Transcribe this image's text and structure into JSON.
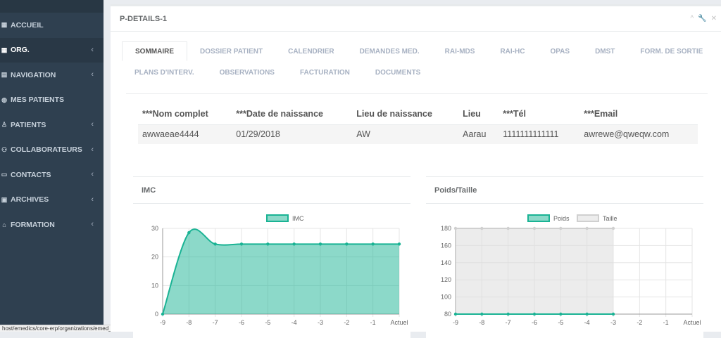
{
  "sidebar": {
    "items": [
      {
        "label": "ACCUEIL",
        "icon": "grid-icon",
        "chevron": false
      },
      {
        "label": "ORG.",
        "icon": "grid-icon",
        "chevron": true,
        "active": true
      },
      {
        "label": "NAVIGATION",
        "icon": "navigation-icon",
        "chevron": true
      },
      {
        "label": "MES PATIENTS",
        "icon": "globe-icon",
        "chevron": false
      },
      {
        "label": "PATIENTS",
        "icon": "user-icon",
        "chevron": true
      },
      {
        "label": "COLLABORATEURS",
        "icon": "users-icon",
        "chevron": true
      },
      {
        "label": "CONTACTS",
        "icon": "contact-card-icon",
        "chevron": true
      },
      {
        "label": "ARCHIVES",
        "icon": "archive-icon",
        "chevron": true
      },
      {
        "label": "FORMATION",
        "icon": "graduation-cap-icon",
        "chevron": true
      }
    ],
    "chevron_glyph": "‹"
  },
  "status_url": "host/emedics/core-erp/organizations/emed_org_update.php",
  "panel": {
    "title": "P-DETAILS-1",
    "tools": [
      "^",
      "🔧",
      "✕"
    ]
  },
  "tabs_row1": [
    "SOMMAIRE",
    "DOSSIER PATIENT",
    "CALENDRIER",
    "DEMANDES MED.",
    "RAI-MDS",
    "RAI-HC",
    "OPAS",
    "DMST",
    "FORM. DE SORTIE"
  ],
  "tabs_row2": [
    "PLANS D'INTERV.",
    "OBSERVATIONS",
    "FACTURATION",
    "DOCUMENTS"
  ],
  "patient_table": {
    "headers": [
      "***Nom complet",
      "***Date de naissance",
      "Lieu de naissance",
      "Lieu",
      "***Tél",
      "***Email"
    ],
    "row": [
      "awwaeae4444",
      "01/29/2018",
      "AW",
      "Aarau",
      "1111111111111",
      "awrewe@qweqw.com"
    ]
  },
  "imc_box": {
    "title": "IMC"
  },
  "poids_box": {
    "title": "Poids/Taille"
  },
  "chart_data": [
    {
      "type": "area",
      "title": "",
      "categories": [
        "-9",
        "-8",
        "-7",
        "-6",
        "-5",
        "-4",
        "-3",
        "-2",
        "-1",
        "Actuel"
      ],
      "series": [
        {
          "name": "IMC",
          "values": [
            0,
            28.5,
            24.5,
            24.5,
            24.5,
            24.5,
            24.5,
            24.5,
            24.5,
            24.5
          ],
          "color": "#1ab394"
        }
      ],
      "ylim": [
        0,
        30
      ],
      "yticks": [
        0,
        10,
        20,
        30
      ],
      "legend": "top",
      "grid": true
    },
    {
      "type": "area",
      "title": "",
      "categories": [
        "-9",
        "-8",
        "-7",
        "-6",
        "-5",
        "-4",
        "-3",
        "-2",
        "-1",
        "Actuel"
      ],
      "series": [
        {
          "name": "Poids",
          "values": [
            80,
            80,
            80,
            80,
            80,
            80,
            80
          ],
          "color": "#1ab394"
        },
        {
          "name": "Taille",
          "values": [
            180,
            180,
            180,
            180,
            180,
            180,
            180
          ],
          "color": "#dcdcdc"
        }
      ],
      "ylim": [
        80,
        180
      ],
      "yticks": [
        80,
        100,
        120,
        140,
        160,
        180
      ],
      "legend": "top",
      "grid": true
    }
  ]
}
